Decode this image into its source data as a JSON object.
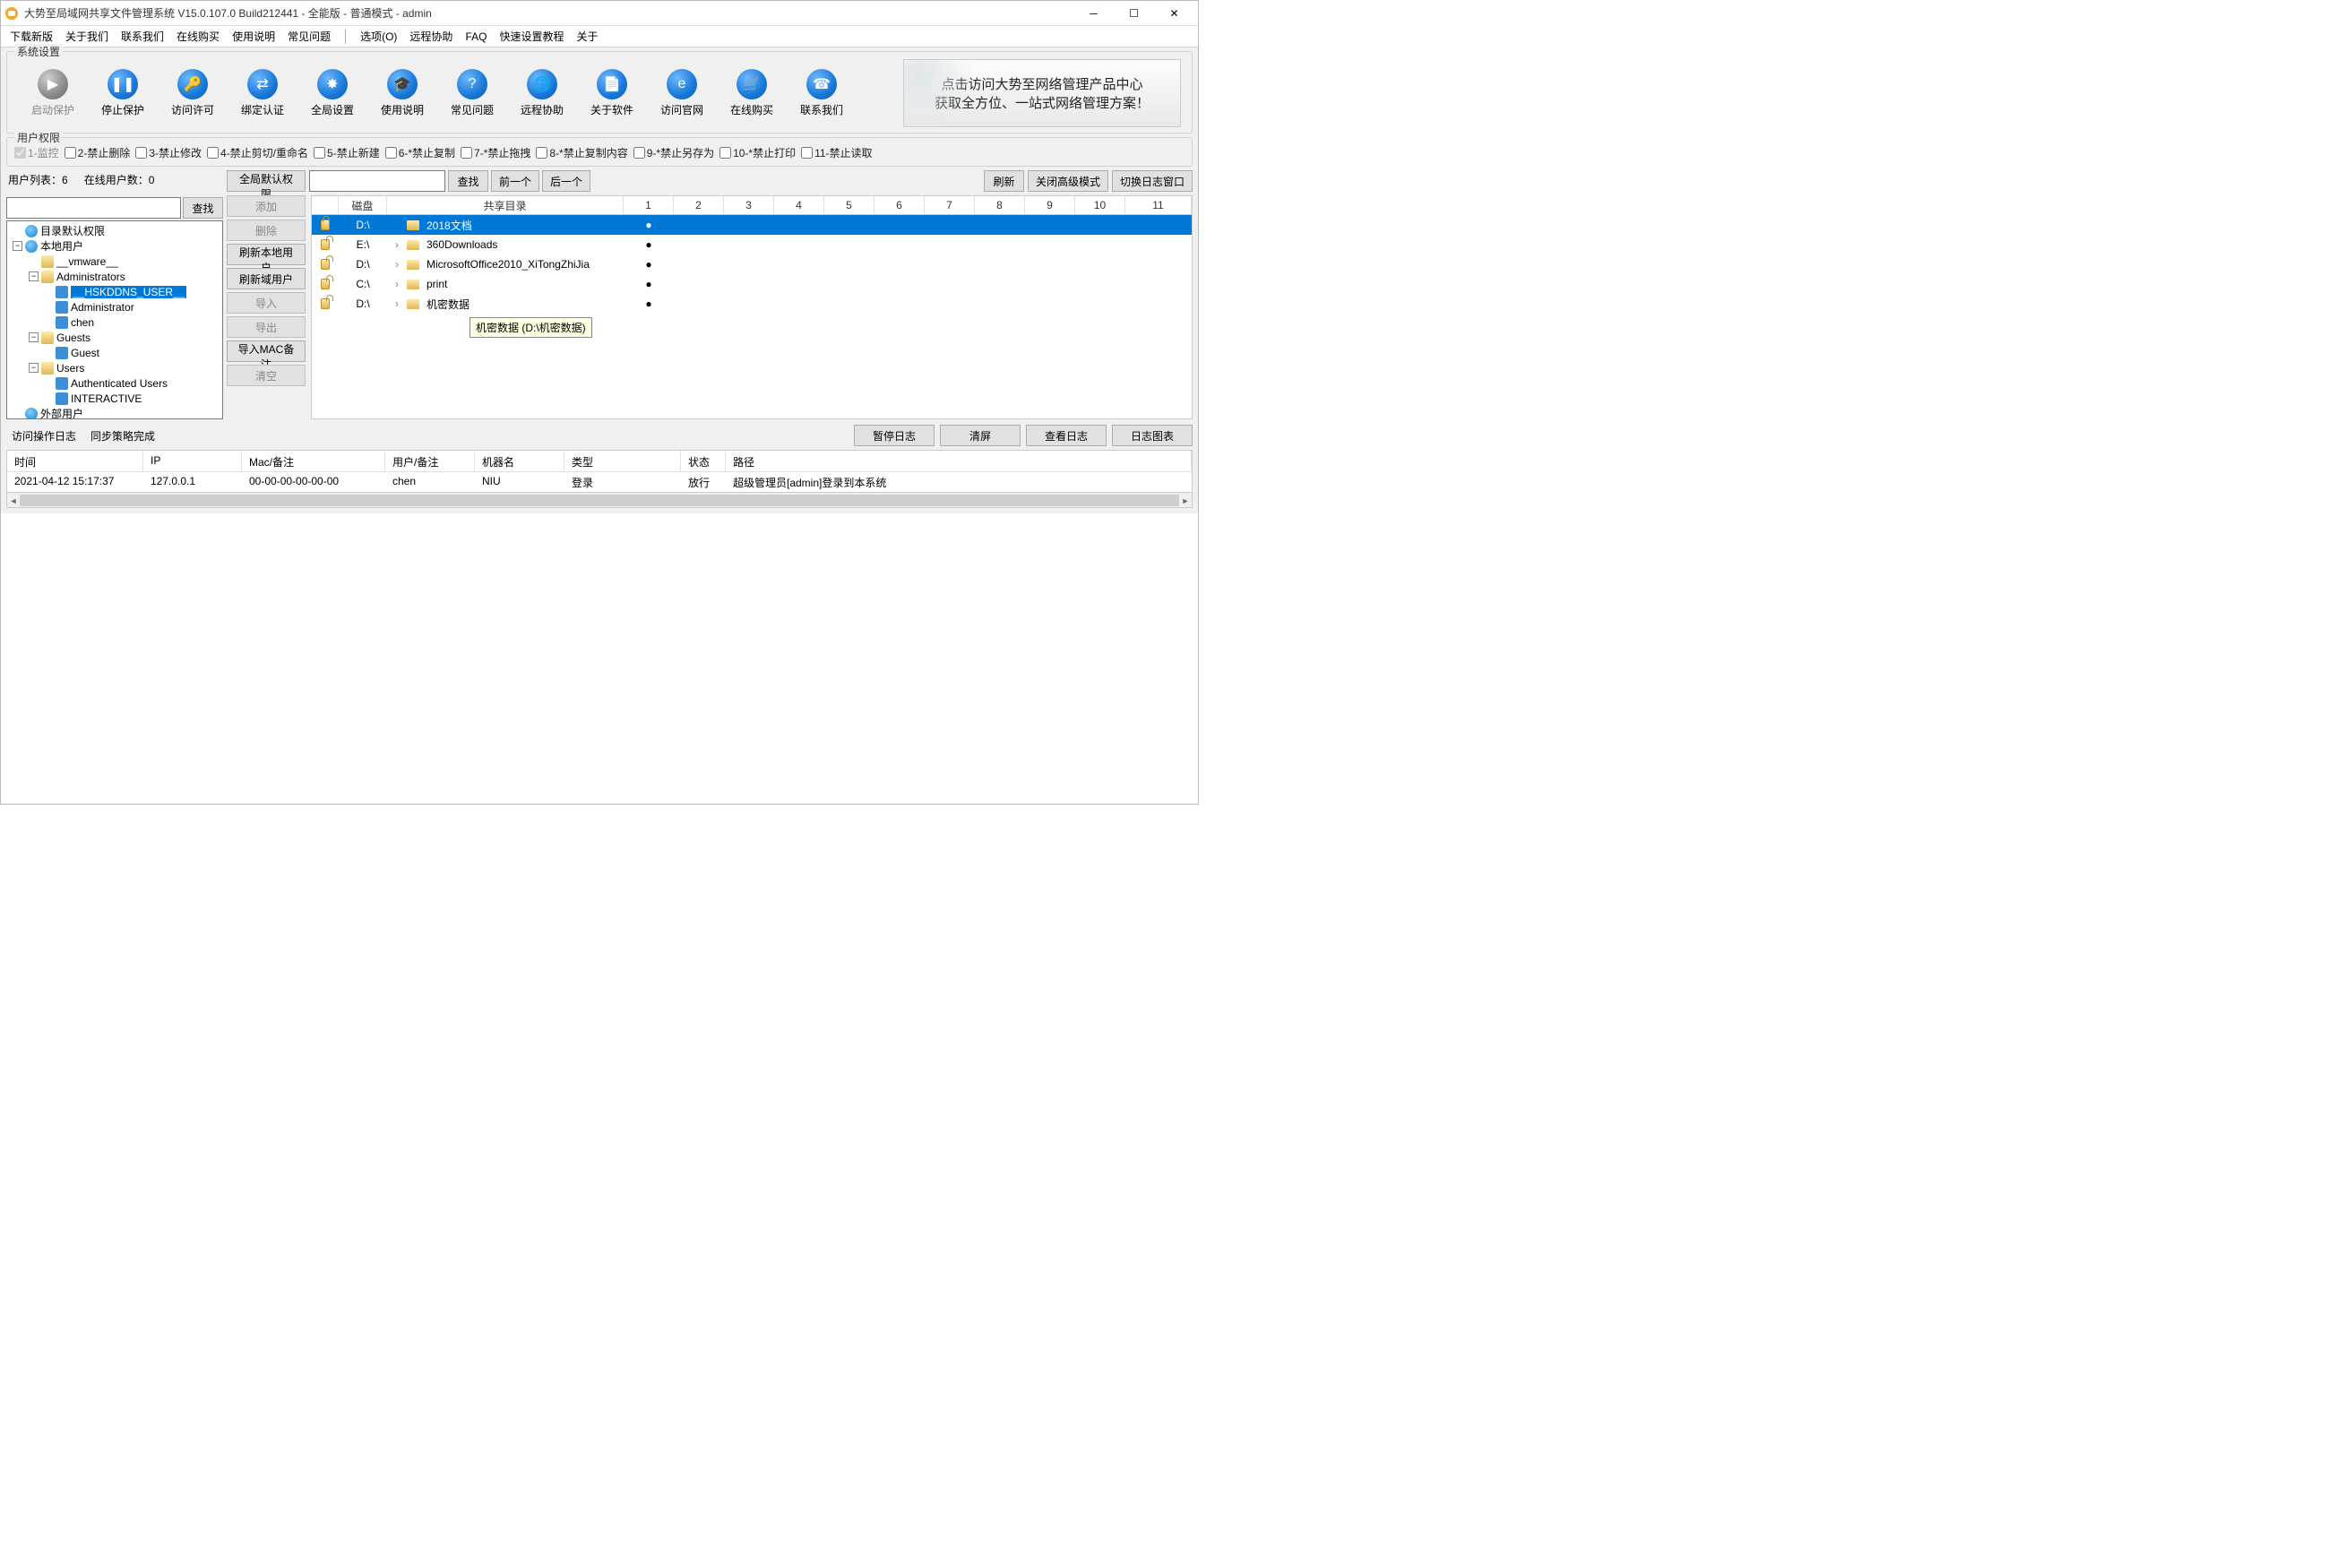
{
  "window": {
    "title": "大势至局域网共享文件管理系统 V15.0.107.0 Build212441 - 全能版 - 普通模式 - admin"
  },
  "menubar": {
    "items_left": [
      "下载新版",
      "关于我们",
      "联系我们",
      "在线购买",
      "使用说明",
      "常见问题"
    ],
    "items_right": [
      "选项(O)",
      "远程协助",
      "FAQ",
      "快速设置教程",
      "关于"
    ]
  },
  "sys_settings": {
    "legend": "系统设置",
    "buttons": [
      {
        "label": "启动保护",
        "icon": "▶",
        "disabled": true
      },
      {
        "label": "停止保护",
        "icon": "❚❚",
        "disabled": false
      },
      {
        "label": "访问许可",
        "icon": "🔑",
        "disabled": false
      },
      {
        "label": "绑定认证",
        "icon": "⇄",
        "disabled": false
      },
      {
        "label": "全局设置",
        "icon": "✸",
        "disabled": false
      },
      {
        "label": "使用说明",
        "icon": "🎓",
        "disabled": false
      },
      {
        "label": "常见问题",
        "icon": "?",
        "disabled": false
      },
      {
        "label": "远程协助",
        "icon": "🌐",
        "disabled": false
      },
      {
        "label": "关于软件",
        "icon": "📄",
        "disabled": false
      },
      {
        "label": "访问官网",
        "icon": "e",
        "disabled": false
      },
      {
        "label": "在线购买",
        "icon": "🛒",
        "disabled": false
      },
      {
        "label": "联系我们",
        "icon": "☎",
        "disabled": false
      }
    ],
    "banner_line1": "点击访问大势至网络管理产品中心",
    "banner_line2": "获取全方位、一站式网络管理方案！"
  },
  "user_perm": {
    "legend": "用户权限",
    "items": [
      {
        "label": "1-监控",
        "checked": true,
        "disabled": true
      },
      {
        "label": "2-禁止删除",
        "checked": false,
        "disabled": false
      },
      {
        "label": "3-禁止修改",
        "checked": false,
        "disabled": false
      },
      {
        "label": "4-禁止剪切/重命名",
        "checked": false,
        "disabled": false
      },
      {
        "label": "5-禁止新建",
        "checked": false,
        "disabled": false
      },
      {
        "label": "6-*禁止复制",
        "checked": false,
        "disabled": false
      },
      {
        "label": "7-*禁止拖拽",
        "checked": false,
        "disabled": false
      },
      {
        "label": "8-*禁止复制内容",
        "checked": false,
        "disabled": false
      },
      {
        "label": "9-*禁止另存为",
        "checked": false,
        "disabled": false
      },
      {
        "label": "10-*禁止打印",
        "checked": false,
        "disabled": false
      },
      {
        "label": "11-禁止读取",
        "checked": false,
        "disabled": false
      }
    ]
  },
  "left": {
    "user_list_label": "用户列表：",
    "user_list_count": "6",
    "online_label": "在线用户数：",
    "online_count": "0",
    "search_btn": "查找",
    "tree": {
      "root1": "目录默认权限",
      "root2": "本地用户",
      "vmware": "__vmware__",
      "admins": "Administrators",
      "hskd": "__HSKDDNS_USER__",
      "admin": "Administrator",
      "chen": "chen",
      "guests": "Guests",
      "guest": "Guest",
      "users": "Users",
      "authu": "Authenticated Users",
      "inter": "INTERACTIVE",
      "root3": "外部用户"
    }
  },
  "mid": {
    "global": "全局默认权限",
    "add": "添加",
    "del": "删除",
    "ref_local": "刷新本地用户",
    "ref_domain": "刷新域用户",
    "import": "导入",
    "export": "导出",
    "import_mac": "导入MAC备注",
    "clear": "清空"
  },
  "search_row": {
    "find": "查找",
    "prev": "前一个",
    "next": "后一个",
    "refresh": "刷新",
    "close_adv": "关闭高级模式",
    "switch_log": "切换日志窗口"
  },
  "share": {
    "col_disk": "磁盘",
    "col_dir": "共享目录",
    "nums": [
      "1",
      "2",
      "3",
      "4",
      "5",
      "6",
      "7",
      "8",
      "9",
      "10",
      "11"
    ],
    "rows": [
      {
        "disk": "D:\\",
        "name": "2018文档",
        "locked": true,
        "selected": true,
        "expanded": true
      },
      {
        "disk": "E:\\",
        "name": "360Downloads",
        "locked": false,
        "selected": false,
        "expanded": false
      },
      {
        "disk": "D:\\",
        "name": "MicrosoftOffice2010_XiTongZhiJia",
        "locked": false,
        "selected": false,
        "expanded": false
      },
      {
        "disk": "C:\\",
        "name": "print",
        "locked": false,
        "selected": false,
        "expanded": false
      },
      {
        "disk": "D:\\",
        "name": "机密数据",
        "locked": false,
        "selected": false,
        "expanded": false
      }
    ],
    "tooltip": "机密数据 (D:\\机密数据)"
  },
  "log": {
    "tab1": "访问操作日志",
    "tab2": "同步策略完成",
    "btn_pause": "暂停日志",
    "btn_clear": "清屏",
    "btn_view": "查看日志",
    "btn_chart": "日志图表",
    "cols": {
      "time": "时间",
      "ip": "IP",
      "mac": "Mac/备注",
      "user": "用户/备注",
      "machine": "机器名",
      "type": "类型",
      "status": "状态",
      "path": "路径"
    },
    "row": {
      "time": "2021-04-12 15:17:37",
      "ip": "127.0.0.1",
      "mac": "00-00-00-00-00-00",
      "user": "chen",
      "machine": "NIU",
      "type": "登录",
      "status": "放行",
      "path": "超级管理员[admin]登录到本系统"
    }
  }
}
